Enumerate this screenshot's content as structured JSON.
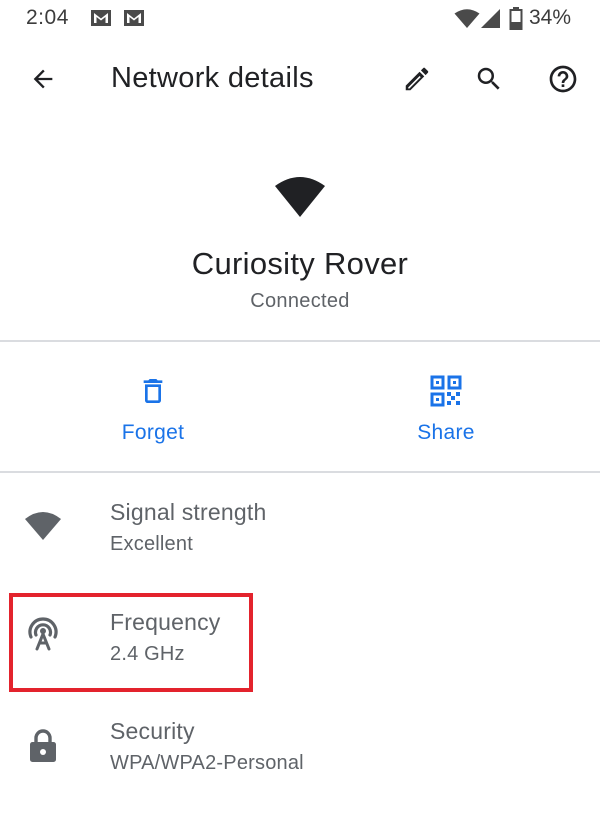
{
  "status_bar": {
    "time": "2:04",
    "notification_icons": [
      "gmail-icon",
      "gmail-icon"
    ],
    "battery_text": "34%"
  },
  "app_bar": {
    "title": "Network details",
    "back_icon": "arrow-back-icon",
    "actions": [
      "edit-icon",
      "search-icon",
      "help-icon"
    ]
  },
  "network": {
    "name": "Curiosity Rover",
    "status": "Connected"
  },
  "actions": {
    "forget_label": "Forget",
    "share_label": "Share"
  },
  "details": [
    {
      "icon": "wifi-signal-icon",
      "title": "Signal strength",
      "value": "Excellent"
    },
    {
      "icon": "frequency-antenna-icon",
      "title": "Frequency",
      "value": "2.4 GHz"
    },
    {
      "icon": "lock-icon",
      "title": "Security",
      "value": "WPA/WPA2-Personal"
    }
  ],
  "colors": {
    "accent": "#1a73e8",
    "highlight": "#e3232d",
    "secondary_text": "#5f6368",
    "icon_gray": "#5f6368"
  }
}
